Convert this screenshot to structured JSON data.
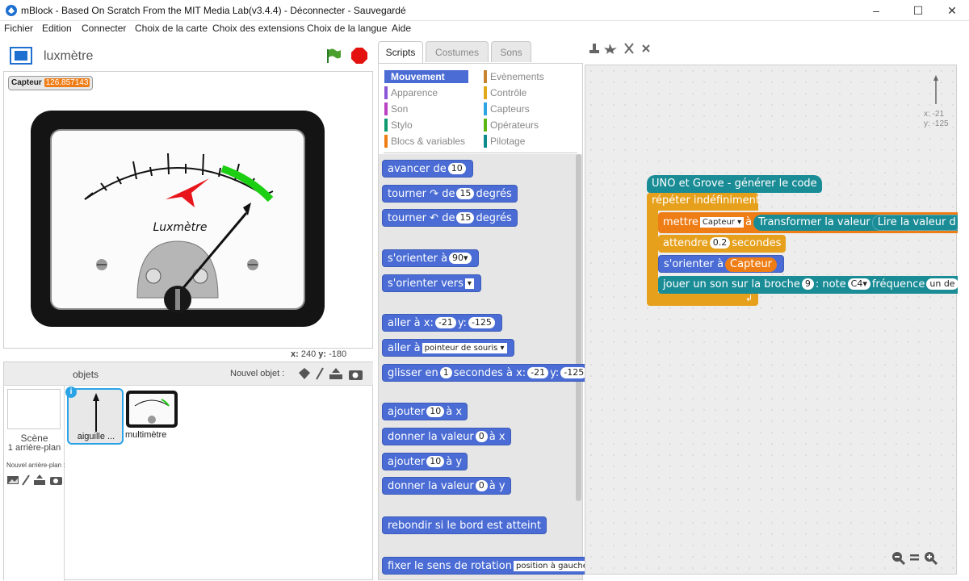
{
  "window": {
    "title": "mBlock - Based On Scratch From the MIT Media Lab(v3.4.4) - Déconnecter - Sauvegardé",
    "minimize": "–",
    "maximize": "☐",
    "close": "✕"
  },
  "menu": [
    "Fichier",
    "Edition",
    "Connecter",
    "Choix de la carte",
    "Choix des extensions",
    "Choix de la langue",
    "Aide"
  ],
  "stage": {
    "project_name": "luxmètre",
    "variable_name": "Capteur",
    "variable_value": "126.857143",
    "meter_label": "Luxmètre",
    "coords_x_label": "x:",
    "coords_x": "240",
    "coords_y_label": "y:",
    "coords_y": "-180"
  },
  "sprites_panel": {
    "header": "objets",
    "new_object_label": "Nouvel objet :",
    "scene_label": "Scène",
    "scene_sub": "1 arrière-plan",
    "new_backdrop_label": "Nouvel arrière-plan :",
    "sprites": [
      {
        "name": "aiguille ..."
      },
      {
        "name": "multimètre"
      }
    ]
  },
  "tabs": [
    "Scripts",
    "Costumes",
    "Sons"
  ],
  "categories_left": [
    {
      "label": "Mouvement",
      "color": "#4a6cd4"
    },
    {
      "label": "Apparence",
      "color": "#8a55d7"
    },
    {
      "label": "Son",
      "color": "#bb42c3"
    },
    {
      "label": "Stylo",
      "color": "#0e9a6c"
    },
    {
      "label": "Blocs & variables",
      "color": "#ee7d16"
    }
  ],
  "categories_right": [
    {
      "label": "Evènements",
      "color": "#c88330"
    },
    {
      "label": "Contrôle",
      "color": "#e1a91a"
    },
    {
      "label": "Capteurs",
      "color": "#2ca5e2"
    },
    {
      "label": "Opérateurs",
      "color": "#5cb712"
    },
    {
      "label": "Pilotage",
      "color": "#0d8b8b"
    }
  ],
  "palette_blocks": {
    "b1": {
      "t1": "avancer de",
      "n1": "10"
    },
    "b2": {
      "t1": "tourner",
      "t2": "de",
      "n1": "15",
      "t3": "degrés"
    },
    "b3": {
      "t1": "tourner",
      "t2": "de",
      "n1": "15",
      "t3": "degrés"
    },
    "b4": {
      "t1": "s'orienter à",
      "n1": "90▾"
    },
    "b5": {
      "t1": "s'orienter vers",
      "n1": "▾"
    },
    "b6": {
      "t1": "aller à x:",
      "n1": "-21",
      "t2": "y:",
      "n2": "-125"
    },
    "b7": {
      "t1": "aller à",
      "d1": "pointeur de souris ▾"
    },
    "b8": {
      "t1": "glisser en",
      "n1": "1",
      "t2": "secondes à x:",
      "n2": "-21",
      "t3": "y:",
      "n3": "-125"
    },
    "b9": {
      "t1": "ajouter",
      "n1": "10",
      "t2": "à x"
    },
    "b10": {
      "t1": "donner la valeur",
      "n1": "0",
      "t2": "à x"
    },
    "b11": {
      "t1": "ajouter",
      "n1": "10",
      "t2": "à y"
    },
    "b12": {
      "t1": "donner la valeur",
      "n1": "0",
      "t2": "à y"
    },
    "b13": {
      "t1": "rebondir si le bord est atteint"
    },
    "b14": {
      "t1": "fixer le sens de rotation",
      "d1": "position à gauche-droite"
    }
  },
  "script": {
    "hat": "UNO et Grove - générer le code",
    "forever": "répéter indéfiniment",
    "set": {
      "t1": "mettre",
      "var": "Capteur ▾",
      "t2": "à",
      "r1": "Transformer la valeur",
      "r2": "Lire la valeur d"
    },
    "wait": {
      "t1": "attendre",
      "n1": "0.2",
      "t2": "secondes"
    },
    "orient": {
      "t1": "s'orienter à",
      "r1": "Capteur"
    },
    "tone": {
      "t1": "jouer un son sur la broche",
      "n1": "9",
      "t2": ": note",
      "n2": "C4▾",
      "t3": "fréquence",
      "n3": "un de"
    }
  },
  "sprite_info": {
    "x_label": "x: -21",
    "y_label": "y: -125"
  }
}
